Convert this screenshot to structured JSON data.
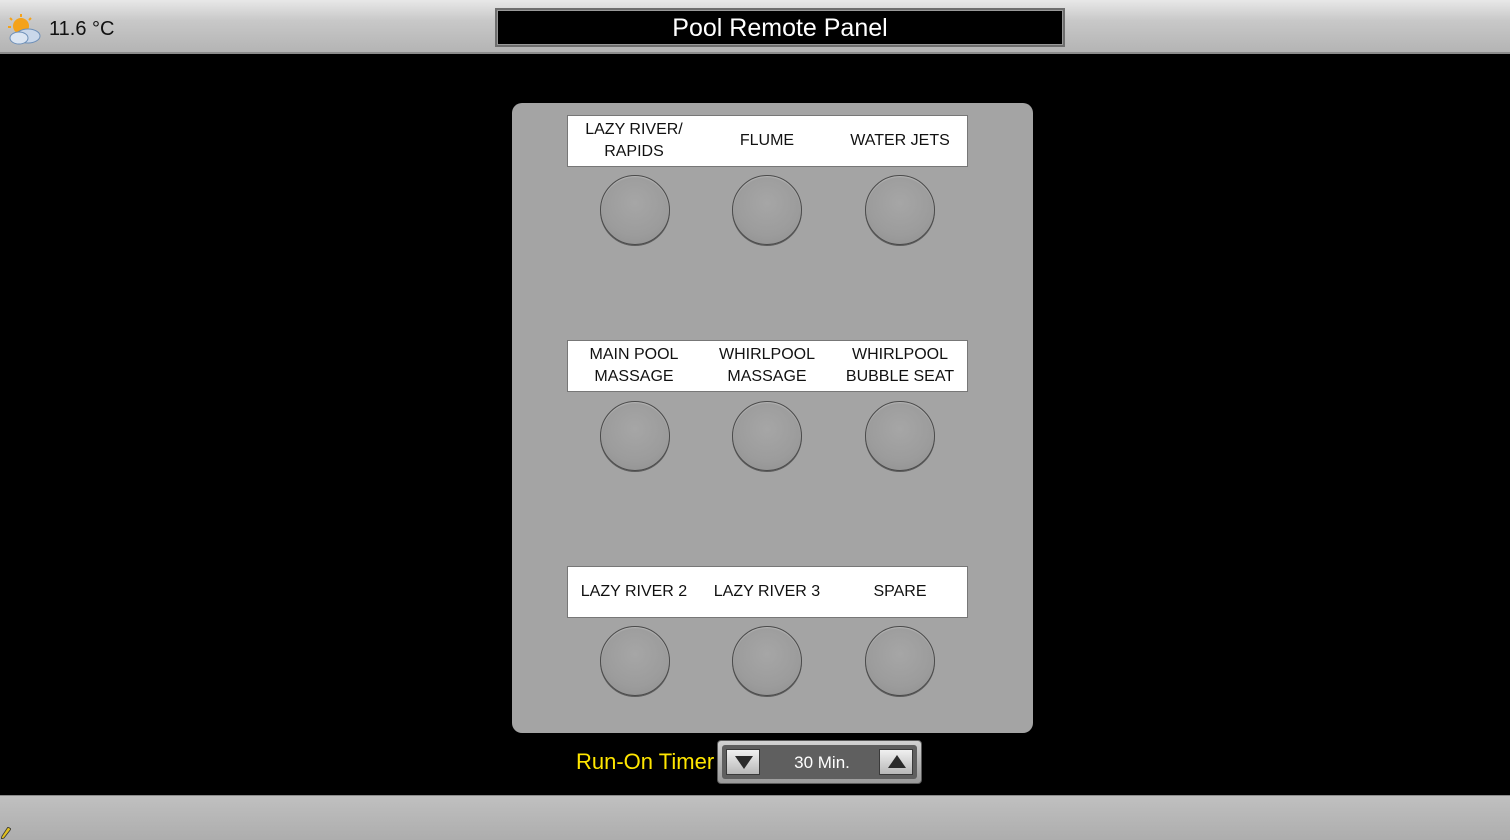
{
  "header": {
    "weather_icon": "partly-cloudy-icon",
    "temperature": "11.6 °C",
    "title": "Pool Remote Panel"
  },
  "panel": {
    "rows": [
      {
        "labels": [
          "LAZY RIVER/\nRAPIDS",
          "FLUME",
          "WATER JETS"
        ]
      },
      {
        "labels": [
          "MAIN POOL\nMASSAGE",
          "WHIRLPOOL\nMASSAGE",
          "WHIRLPOOL\nBUBBLE SEAT"
        ]
      },
      {
        "labels": [
          "LAZY RIVER 2",
          "LAZY RIVER 3",
          "SPARE"
        ]
      }
    ]
  },
  "timer": {
    "label": "Run-On Timer",
    "value": "30 Min.",
    "down_icon": "triangle-down-icon",
    "up_icon": "triangle-up-icon"
  },
  "colors": {
    "timer_label": "#ffe600",
    "panel_bg": "#a4a4a4"
  }
}
